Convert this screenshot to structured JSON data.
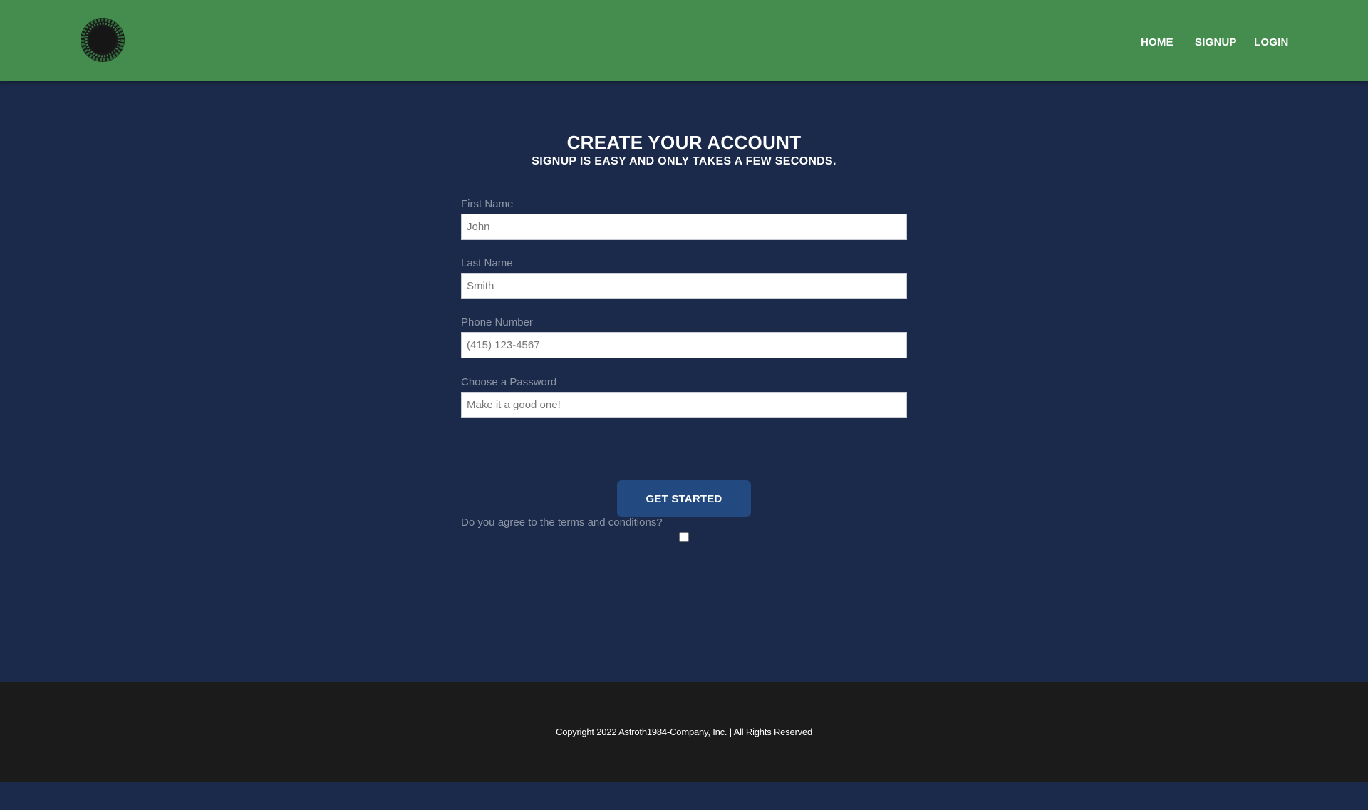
{
  "header": {
    "logo_icon": "circular-seal-logo",
    "nav": [
      "HOME",
      "SIGNUP",
      "LOGIN"
    ]
  },
  "main": {
    "title": "CREATE YOUR ACCOUNT",
    "subtitle": "SIGNUP IS EASY AND ONLY TAKES A FEW SECONDS.",
    "fields": [
      {
        "label": "First Name",
        "placeholder": "John",
        "value": ""
      },
      {
        "label": "Last Name",
        "placeholder": "Smith",
        "value": ""
      },
      {
        "label": "Phone Number",
        "placeholder": "(415) 123-4567",
        "value": ""
      },
      {
        "label": "Choose a Password",
        "placeholder": "Make it a good one!",
        "value": ""
      }
    ],
    "terms_label": "Do you agree to the terms and conditions?",
    "terms_checked": false,
    "submit_label": "GET STARTED"
  },
  "footer": {
    "copyright": "Copyright 2022 Astroth1984-Company, Inc. | All Rights Reserved"
  },
  "colors": {
    "header_bg": "#448d4e",
    "page_bg": "#1b2a4a",
    "button_bg": "#234a80",
    "footer_bg": "#1b1b1b"
  }
}
